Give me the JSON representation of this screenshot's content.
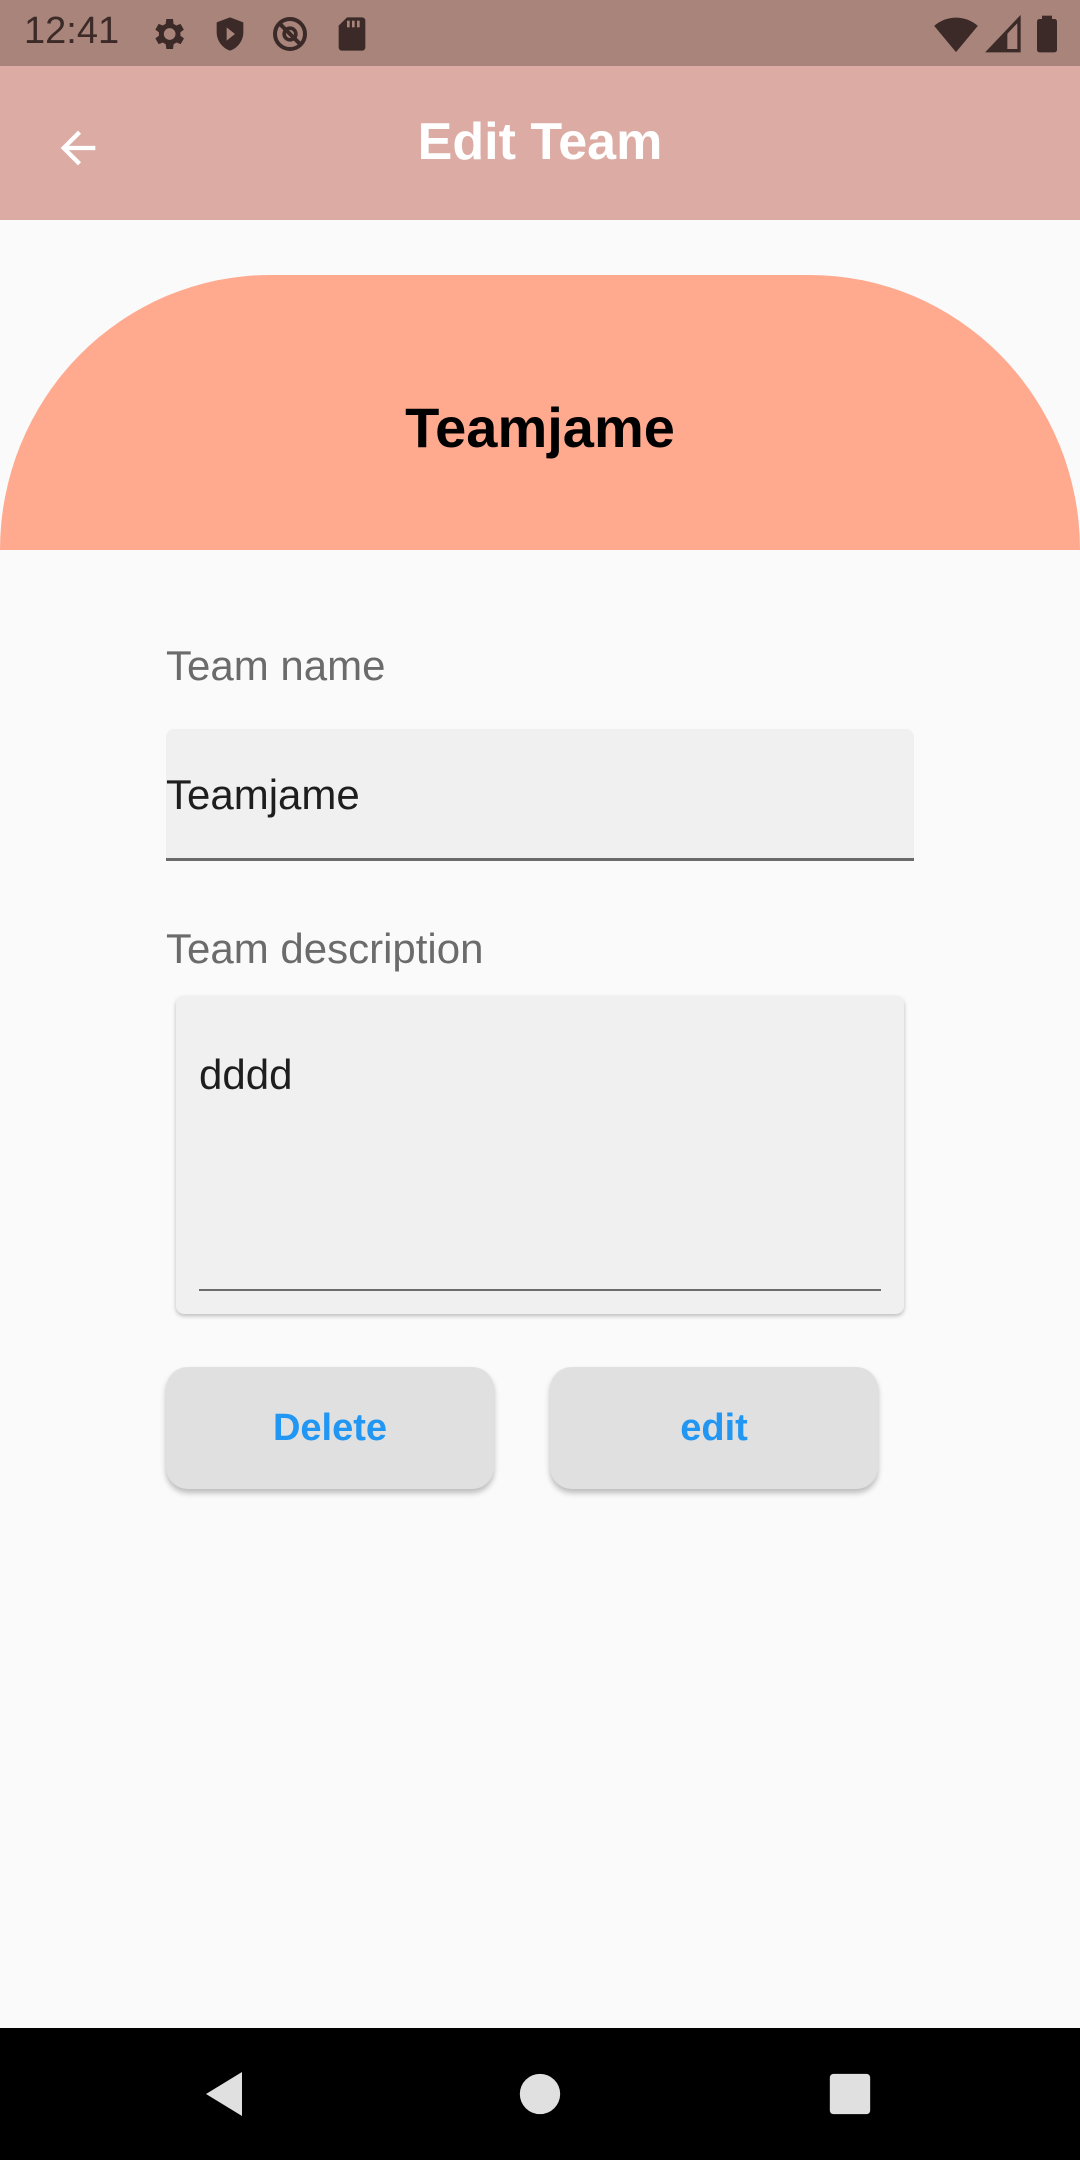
{
  "status_bar": {
    "time": "12:41",
    "left_icons": [
      "gear-icon",
      "shield-icon",
      "no-sync-icon",
      "sd-card-icon"
    ],
    "right_icons": [
      "wifi-icon",
      "cell-signal-icon",
      "battery-icon"
    ]
  },
  "app_bar": {
    "title": "Edit Team",
    "back_icon": "arrow-back-icon",
    "color": "#dcaca4"
  },
  "header": {
    "team_name": "Teamjame",
    "color": "#ffa98f"
  },
  "form": {
    "name_label": "Team name",
    "name_value": "Teamjame",
    "description_label": "Team description",
    "description_value": "dddd"
  },
  "buttons": {
    "delete_label": "Delete",
    "edit_label": "edit",
    "text_color": "#2196f3"
  },
  "nav_bar": {
    "icons": [
      "nav-back-icon",
      "nav-home-icon",
      "nav-recents-icon"
    ]
  }
}
